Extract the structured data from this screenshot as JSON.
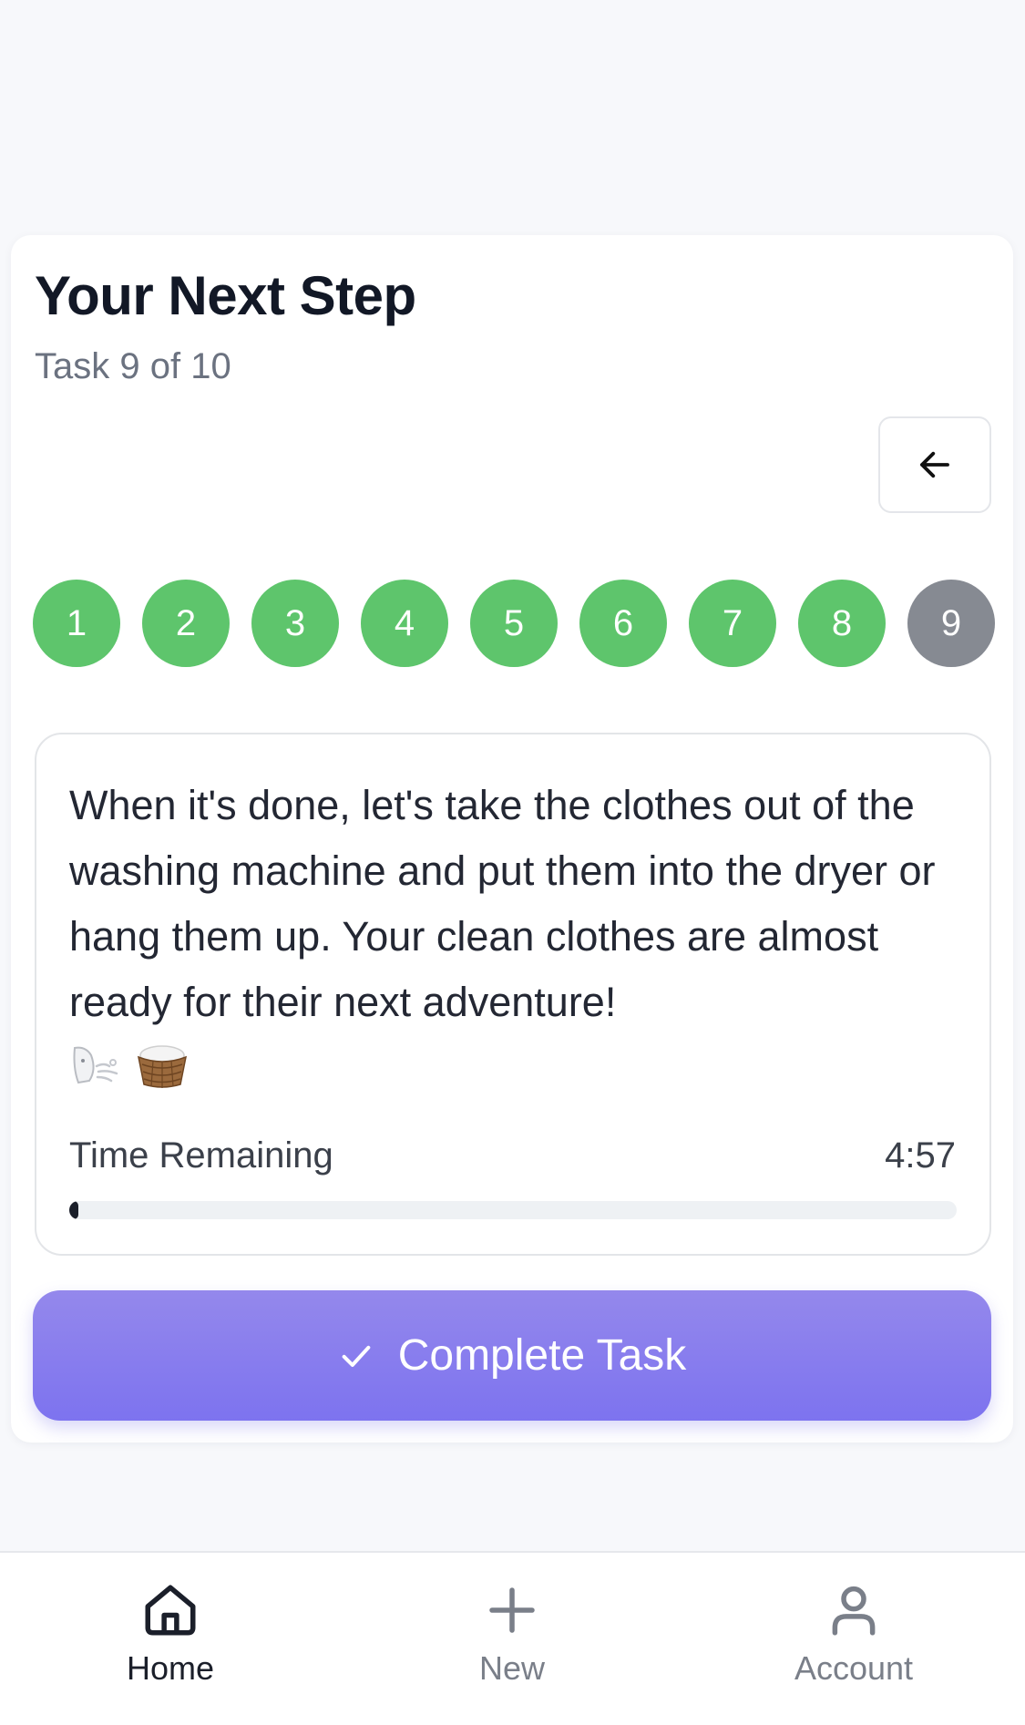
{
  "header": {
    "title": "Your Next Step",
    "subtitle": "Task 9 of 10"
  },
  "back_button": {
    "icon": "arrow-left-icon"
  },
  "steps": [
    {
      "label": "1",
      "status": "done"
    },
    {
      "label": "2",
      "status": "done"
    },
    {
      "label": "3",
      "status": "done"
    },
    {
      "label": "4",
      "status": "done"
    },
    {
      "label": "5",
      "status": "done"
    },
    {
      "label": "6",
      "status": "done"
    },
    {
      "label": "7",
      "status": "done"
    },
    {
      "label": "8",
      "status": "done"
    },
    {
      "label": "9",
      "status": "current"
    }
  ],
  "task": {
    "text": "When it's done, let's take the clothes out of the washing machine and put them into the dryer or hang them up. Your clean clothes are almost ready for their next adventure!",
    "emojis": [
      "wind-face-icon",
      "laundry-basket-icon"
    ]
  },
  "timer": {
    "label": "Time Remaining",
    "value": "4:57",
    "progress_fraction": 0.01
  },
  "complete_button": {
    "label": "Complete Task",
    "icon": "checkmark-icon"
  },
  "tabbar": {
    "items": [
      {
        "label": "Home",
        "icon": "home-icon",
        "active": true
      },
      {
        "label": "New",
        "icon": "plus-icon",
        "active": false
      },
      {
        "label": "Account",
        "icon": "user-icon",
        "active": false
      }
    ]
  },
  "colors": {
    "done": "#5ec56c",
    "current": "#868a92",
    "button_top": "#9488ec",
    "button_bottom": "#7d73ef"
  }
}
